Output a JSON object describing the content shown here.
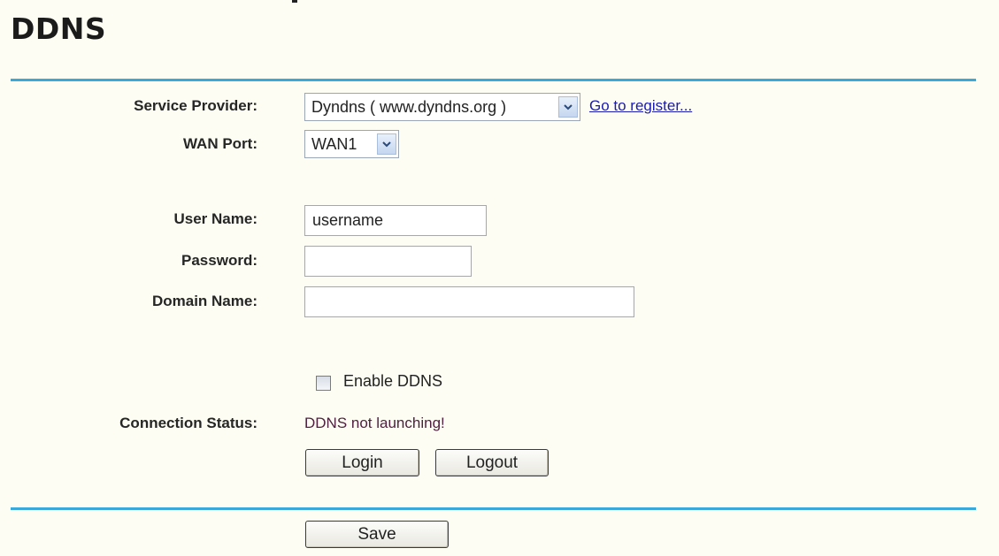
{
  "page": {
    "title": "DDNS"
  },
  "form": {
    "service_provider": {
      "label": "Service Provider:",
      "selected": "Dyndns ( www.dyndns.org )",
      "link": "Go to register..."
    },
    "wan_port": {
      "label": "WAN Port:",
      "selected": "WAN1"
    },
    "user_name": {
      "label": "User Name:",
      "value": "username"
    },
    "password": {
      "label": "Password:",
      "value": ""
    },
    "domain_name": {
      "label": "Domain Name:",
      "value": ""
    },
    "enable_ddns": {
      "label": "Enable DDNS",
      "checked": false
    },
    "connection_status": {
      "label": "Connection Status:",
      "value": "DDNS not launching!"
    }
  },
  "buttons": {
    "login": "Login",
    "logout": "Logout",
    "save": "Save"
  },
  "colors": {
    "accent_rule": "#3aa8d8",
    "link": "#1a1ab0",
    "status_text": "#502040",
    "background": "#fdfdf3"
  },
  "icons": {
    "dropdown": "chevron-down-icon",
    "checkbox": "checkbox-icon"
  }
}
